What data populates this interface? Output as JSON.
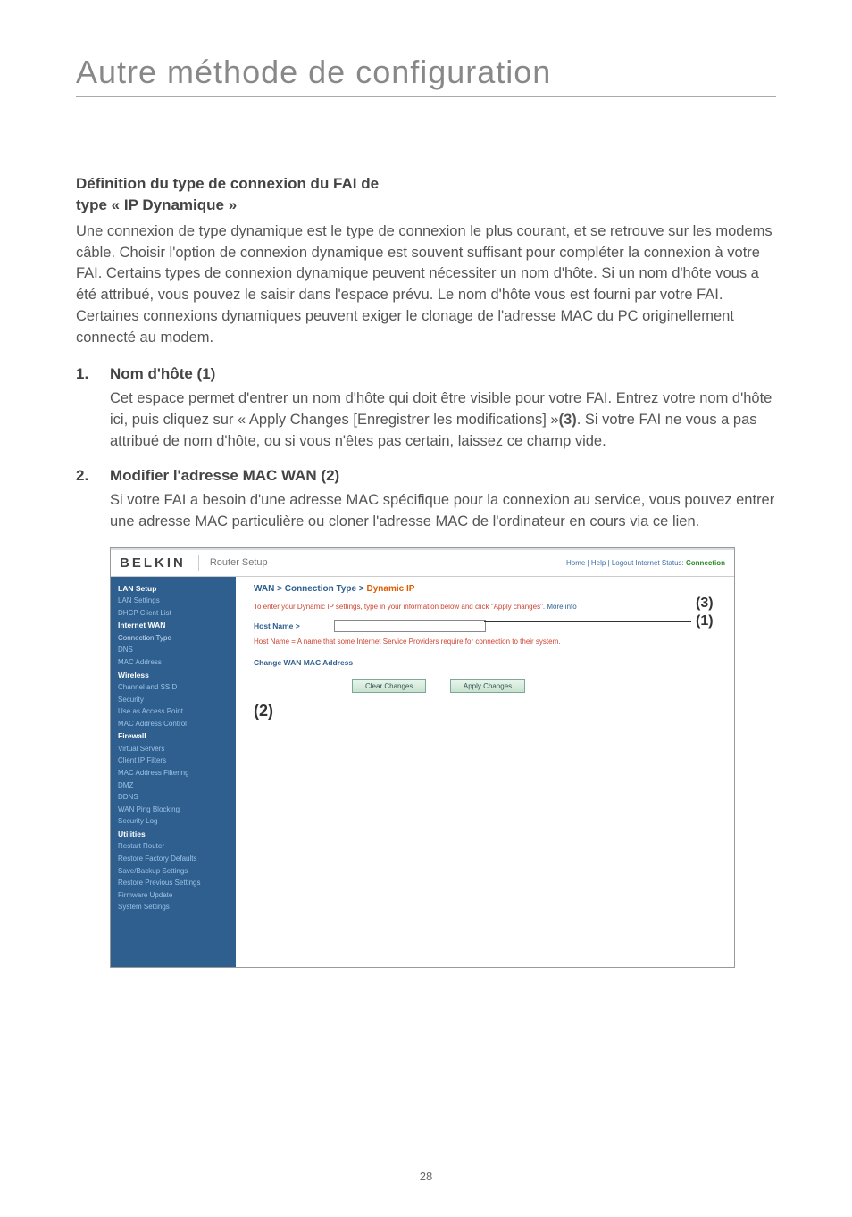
{
  "page_title": "Autre méthode de configuration",
  "section_heading_line1": "Définition du type de connexion du FAI de",
  "section_heading_line2": "type « IP Dynamique »",
  "intro_paragraph": "Une connexion de type dynamique est le type de connexion le plus courant, et se retrouve sur les modems câble. Choisir l'option de connexion dynamique est souvent suffisant pour compléter la connexion à votre FAI. Certains types de connexion dynamique peuvent nécessiter un nom d'hôte. Si un nom d'hôte vous a été attribué, vous pouvez le saisir dans l'espace prévu. Le nom d'hôte vous est fourni par votre FAI. Certaines connexions dynamiques peuvent exiger le clonage de l'adresse MAC du PC originellement connecté au modem.",
  "item1": {
    "num": "1.",
    "label": "Nom d'hôte (1)",
    "body_a": "Cet espace permet d'entrer un nom d'hôte qui doit être visible pour votre FAI. Entrez votre nom d'hôte ici, puis cliquez sur « Apply Changes [Enregistrer les modifications] »",
    "body_bold": "(3)",
    "body_b": ". Si votre FAI ne vous a pas attribué de nom d'hôte, ou si vous n'êtes pas certain, laissez ce champ vide."
  },
  "item2": {
    "num": "2.",
    "label": "Modifier l'adresse MAC WAN (2)",
    "body": "Si votre FAI a besoin d'une adresse MAC spécifique pour la connexion au service, vous pouvez entrer une adresse MAC particulière ou cloner l'adresse MAC de l'ordinateur en cours via ce lien."
  },
  "screenshot": {
    "brand": "BELKIN",
    "setup_label": "Router Setup",
    "status_prefix": "Home | Help | Logout    Internet Status: ",
    "status_value": "Connection",
    "sidebar": {
      "lan_setup": "LAN Setup",
      "lan_settings": "LAN Settings",
      "dhcp_client": "DHCP Client List",
      "internet_wan": "Internet WAN",
      "connection_type": "Connection Type",
      "dns": "DNS",
      "mac_address": "MAC Address",
      "wireless": "Wireless",
      "channel_ssid": "Channel and SSID",
      "security": "Security",
      "use_ap": "Use as Access Point",
      "mac_control": "MAC Address Control",
      "firewall": "Firewall",
      "virtual_servers": "Virtual Servers",
      "client_ip": "Client IP Filters",
      "mac_filtering": "MAC Address Filtering",
      "dmz": "DMZ",
      "ddns": "DDNS",
      "wan_ping": "WAN Ping Blocking",
      "security_log": "Security Log",
      "utilities": "Utilities",
      "restart": "Restart Router",
      "restore_factory": "Restore Factory Defaults",
      "save_backup": "Save/Backup Settings",
      "restore_prev": "Restore Previous Settings",
      "firmware": "Firmware Update",
      "system": "System Settings"
    },
    "main": {
      "crumb_wan": "WAN > ",
      "crumb_ct": "Connection Type > ",
      "crumb_dyn": "Dynamic IP",
      "instruction": "To enter your Dynamic IP settings, type in your information below and click \"Apply changes\". ",
      "more_info": "More info",
      "host_name_label": "Host Name >",
      "host_name_value": "",
      "host_note": "Host Name = A name that some Internet Service Providers require for connection to their system.",
      "change_mac": "Change WAN MAC Address",
      "clear_btn": "Clear Changes",
      "apply_btn": "Apply Changes"
    },
    "callouts": {
      "c1": "(1)",
      "c2": "(2)",
      "c3": "(3)"
    }
  },
  "page_number": "28"
}
